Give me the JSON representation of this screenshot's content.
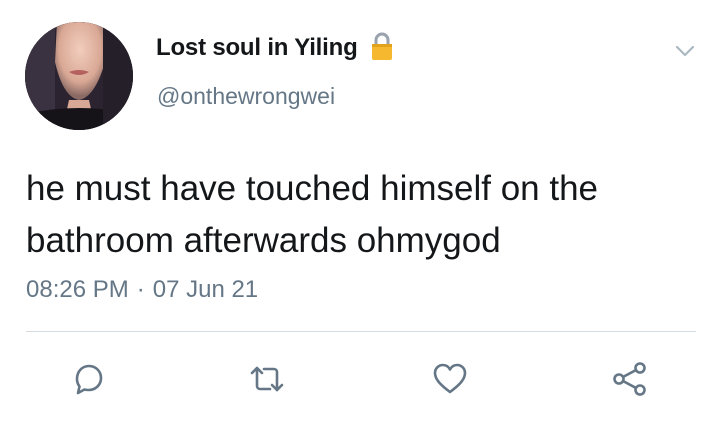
{
  "user": {
    "display_name": "Lost soul in Yiling",
    "handle": "@onthewrongwei",
    "protected": true
  },
  "tweet": {
    "text": "he must have touched himself on the bathroom afterwards ohmygod",
    "time": "08:26 PM",
    "separator": "·",
    "date": "07 Jun 21"
  },
  "icons": {
    "lock": "lock-icon",
    "menu": "chevron-down-icon",
    "reply": "reply-icon",
    "retweet": "retweet-icon",
    "like": "heart-icon",
    "share": "share-icon"
  },
  "colors": {
    "text": "#14171a",
    "secondary": "#657786",
    "lock": "#f5b82e",
    "divider": "#d6dbe0"
  }
}
